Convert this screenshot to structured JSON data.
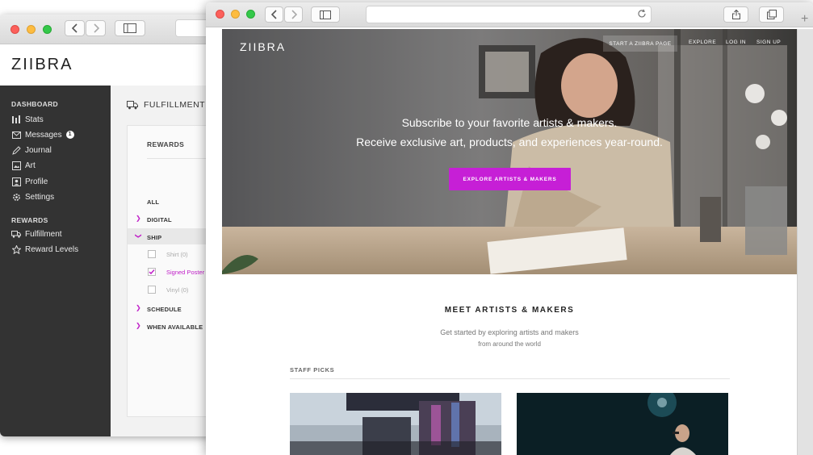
{
  "dashboard_window": {
    "logo": "ZIIBRA",
    "sidebar": {
      "dashboard_title": "DASHBOARD",
      "items": [
        {
          "label": "Stats",
          "icon": "stats-icon"
        },
        {
          "label": "Messages",
          "icon": "messages-icon",
          "badge": "1"
        },
        {
          "label": "Journal",
          "icon": "journal-icon"
        },
        {
          "label": "Art",
          "icon": "art-icon"
        },
        {
          "label": "Profile",
          "icon": "profile-icon"
        },
        {
          "label": "Settings",
          "icon": "settings-icon"
        }
      ],
      "rewards_title": "REWARDS",
      "reward_items": [
        {
          "label": "Fulfillment",
          "icon": "truck-icon"
        },
        {
          "label": "Reward Levels",
          "icon": "star-icon"
        }
      ]
    },
    "main": {
      "title": "FULFILLMENT",
      "panel_title": "REWARDS",
      "filters": [
        "ALL",
        "DIGITAL",
        "SHIP",
        "SCHEDULE",
        "WHEN AVAILABLE"
      ],
      "ship_items": [
        {
          "label": "Shirt (0)",
          "checked": false
        },
        {
          "label": "Signed Poster",
          "checked": true
        },
        {
          "label": "Vinyl (0)",
          "checked": false
        }
      ]
    }
  },
  "site_window": {
    "nav": {
      "logo": "ZIIBRA",
      "start_label": "START A ZIIBRA PAGE",
      "explore_label": "EXPLORE",
      "login_label": "LOG IN",
      "signup_label": "SIGN UP"
    },
    "hero": {
      "line1": "Subscribe to your favorite artists & makers.",
      "line2": "Receive exclusive art, products, and experiences year-round.",
      "cta": "EXPLORE ARTISTS & MAKERS"
    },
    "section": {
      "title": "MEET ARTISTS & MAKERS",
      "subtitle1": "Get started by exploring artists and makers",
      "subtitle2": "from around the world",
      "staff_picks": "STAFF PICKS"
    },
    "colors": {
      "accent": "#c61fd6",
      "sidebar": "#333333"
    }
  }
}
